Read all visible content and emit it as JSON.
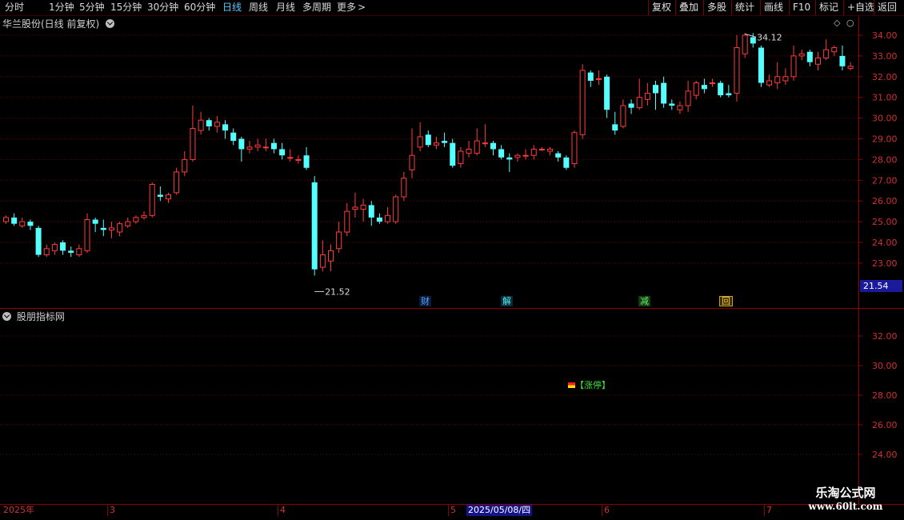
{
  "toolbar": {
    "periods": [
      "分时",
      "1分钟",
      "5分钟",
      "15分钟",
      "30分钟",
      "60分钟",
      "日线",
      "周线",
      "月线",
      "多周期",
      "更多"
    ],
    "active_period": "日线",
    "right_buttons": [
      "复权",
      "叠加",
      "多股",
      "统计",
      "画线",
      "F10",
      "标记",
      "+自选",
      "返回"
    ]
  },
  "main_pane": {
    "title": "华兰股份(日线 前复权)",
    "y_ticks": [
      "34.00",
      "33.00",
      "32.00",
      "31.00",
      "30.00",
      "29.00",
      "28.00",
      "27.00",
      "26.00",
      "25.00",
      "24.00",
      "23.00"
    ],
    "high_label": "34.12",
    "low_label": "21.52",
    "current_price": "21.54",
    "markers": [
      "财",
      "解",
      "减",
      "回"
    ]
  },
  "sub_pane": {
    "title": "股朋指标网",
    "y_ticks": [
      "32.00",
      "30.00",
      "28.00",
      "26.00",
      "24.00"
    ],
    "signal_label": "【涨停】"
  },
  "date_axis": {
    "labels": [
      "2025年",
      "3",
      "4",
      "5",
      "6",
      "7"
    ],
    "cursor_date": "2025/05/08/四"
  },
  "watermark": {
    "line1": "乐淘公式网",
    "line2": "www.60lt.com"
  },
  "colors": {
    "up": "#ff3c3c",
    "down": "#54ffff",
    "grid": "#7a0000",
    "accent": "#5cc8ff"
  },
  "chart_data": {
    "type": "candlestick",
    "ylim": [
      21.0,
      34.5
    ],
    "high": 34.12,
    "low": 21.52,
    "candles": [
      [
        25.0,
        25.2,
        24.9,
        25.3
      ],
      [
        25.2,
        24.9,
        24.8,
        25.4
      ],
      [
        24.8,
        25.0,
        24.7,
        25.2
      ],
      [
        25.0,
        24.8,
        24.6,
        25.1
      ],
      [
        24.7,
        23.4,
        23.3,
        24.8
      ],
      [
        23.4,
        23.7,
        23.3,
        23.9
      ],
      [
        23.6,
        23.9,
        23.4,
        24.0
      ],
      [
        24.0,
        23.6,
        23.4,
        24.1
      ],
      [
        23.6,
        23.5,
        23.3,
        23.8
      ],
      [
        23.4,
        23.7,
        23.3,
        23.9
      ],
      [
        23.6,
        25.1,
        23.5,
        25.4
      ],
      [
        25.1,
        24.9,
        24.5,
        25.2
      ],
      [
        24.7,
        24.6,
        24.3,
        25.1
      ],
      [
        24.6,
        24.7,
        24.2,
        25.0
      ],
      [
        24.5,
        24.9,
        24.3,
        25.0
      ],
      [
        24.8,
        25.0,
        24.7,
        25.2
      ],
      [
        25.0,
        25.2,
        24.9,
        25.3
      ],
      [
        25.2,
        25.3,
        25.1,
        25.5
      ],
      [
        25.3,
        26.8,
        25.2,
        26.9
      ],
      [
        26.3,
        26.2,
        26.0,
        26.7
      ],
      [
        26.1,
        26.3,
        25.9,
        26.4
      ],
      [
        26.4,
        27.4,
        26.3,
        27.6
      ],
      [
        27.4,
        28.0,
        27.2,
        28.4
      ],
      [
        28.0,
        29.5,
        27.9,
        30.6
      ],
      [
        29.4,
        29.9,
        29.2,
        30.3
      ],
      [
        29.9,
        29.6,
        29.4,
        30.0
      ],
      [
        29.6,
        29.8,
        29.3,
        30.1
      ],
      [
        29.7,
        29.4,
        29.0,
        29.9
      ],
      [
        29.3,
        28.9,
        28.7,
        29.5
      ],
      [
        29.0,
        28.5,
        27.9,
        29.1
      ],
      [
        28.5,
        28.6,
        28.3,
        28.9
      ],
      [
        28.6,
        28.7,
        28.4,
        29.0
      ],
      [
        28.6,
        28.6,
        28.4,
        29.0
      ],
      [
        28.8,
        28.5,
        28.3,
        29.0
      ],
      [
        28.5,
        28.2,
        28.0,
        28.8
      ],
      [
        28.1,
        28.1,
        27.9,
        28.5
      ],
      [
        28.0,
        28.0,
        27.8,
        28.2
      ],
      [
        28.2,
        27.6,
        27.5,
        28.6
      ],
      [
        26.9,
        22.7,
        22.4,
        27.2
      ],
      [
        22.8,
        23.4,
        22.6,
        24.1
      ],
      [
        23.1,
        23.6,
        22.6,
        23.9
      ],
      [
        23.7,
        24.5,
        23.5,
        25.0
      ],
      [
        24.5,
        25.5,
        24.3,
        25.9
      ],
      [
        25.6,
        25.7,
        25.2,
        26.4
      ],
      [
        25.6,
        25.8,
        25.0,
        26.1
      ],
      [
        25.8,
        25.2,
        24.8,
        26.0
      ],
      [
        25.2,
        25.0,
        24.9,
        25.4
      ],
      [
        25.0,
        25.3,
        24.9,
        25.7
      ],
      [
        25.0,
        26.2,
        24.9,
        26.3
      ],
      [
        26.2,
        27.1,
        26.0,
        27.4
      ],
      [
        27.5,
        28.2,
        27.1,
        29.5
      ],
      [
        28.6,
        29.1,
        28.4,
        29.8
      ],
      [
        29.2,
        28.7,
        28.6,
        29.4
      ],
      [
        28.7,
        28.8,
        28.5,
        29.1
      ],
      [
        28.9,
        28.8,
        28.6,
        29.3
      ],
      [
        28.8,
        27.7,
        27.6,
        29.0
      ],
      [
        27.8,
        28.4,
        27.6,
        28.6
      ],
      [
        28.3,
        28.5,
        28.1,
        28.9
      ],
      [
        28.3,
        28.9,
        28.2,
        29.5
      ],
      [
        28.8,
        28.8,
        28.6,
        29.7
      ],
      [
        28.8,
        28.5,
        28.2,
        28.9
      ],
      [
        28.5,
        28.1,
        28.0,
        28.7
      ],
      [
        28.1,
        28.0,
        27.4,
        28.3
      ],
      [
        28.1,
        28.2,
        27.9,
        28.3
      ],
      [
        28.2,
        28.2,
        28.0,
        28.5
      ],
      [
        28.2,
        28.5,
        28.0,
        28.7
      ],
      [
        28.5,
        28.5,
        28.4,
        28.6
      ],
      [
        28.4,
        28.5,
        28.2,
        28.6
      ],
      [
        28.3,
        28.1,
        27.9,
        28.4
      ],
      [
        28.1,
        27.6,
        27.5,
        28.2
      ],
      [
        27.8,
        29.3,
        27.6,
        29.4
      ],
      [
        29.2,
        32.3,
        29.0,
        32.6
      ],
      [
        32.2,
        31.8,
        31.5,
        32.3
      ],
      [
        31.9,
        31.9,
        31.6,
        32.3
      ],
      [
        32.0,
        30.4,
        30.0,
        32.1
      ],
      [
        29.7,
        29.4,
        29.2,
        30.3
      ],
      [
        29.6,
        30.6,
        29.5,
        30.9
      ],
      [
        30.7,
        30.5,
        30.2,
        30.9
      ],
      [
        30.5,
        31.0,
        30.4,
        31.9
      ],
      [
        30.9,
        31.2,
        30.6,
        31.7
      ],
      [
        31.6,
        31.2,
        30.4,
        31.8
      ],
      [
        31.7,
        30.7,
        30.5,
        32.0
      ],
      [
        30.7,
        30.6,
        30.4,
        30.9
      ],
      [
        30.4,
        30.6,
        30.2,
        30.8
      ],
      [
        30.6,
        31.3,
        30.3,
        31.8
      ],
      [
        31.1,
        31.7,
        30.9,
        31.8
      ],
      [
        31.6,
        31.4,
        31.2,
        31.9
      ],
      [
        31.7,
        31.7,
        31.5,
        31.9
      ],
      [
        31.7,
        31.1,
        31.0,
        31.8
      ],
      [
        31.2,
        31.1,
        31.0,
        31.6
      ],
      [
        31.2,
        33.4,
        30.8,
        34.0
      ],
      [
        33.1,
        34.0,
        32.9,
        34.1
      ],
      [
        33.9,
        33.6,
        33.4,
        34.1
      ],
      [
        33.4,
        31.7,
        31.5,
        33.5
      ],
      [
        31.6,
        31.8,
        31.5,
        32.1
      ],
      [
        31.7,
        32.0,
        31.4,
        32.7
      ],
      [
        31.8,
        32.0,
        31.6,
        32.4
      ],
      [
        32.0,
        33.0,
        31.8,
        33.5
      ],
      [
        33.0,
        33.1,
        32.8,
        33.3
      ],
      [
        33.2,
        32.7,
        32.5,
        33.3
      ],
      [
        32.6,
        32.9,
        32.3,
        33.2
      ],
      [
        32.9,
        33.3,
        32.8,
        33.8
      ],
      [
        33.2,
        33.4,
        33.0,
        33.5
      ],
      [
        33.0,
        32.5,
        32.3,
        33.5
      ],
      [
        32.4,
        32.5,
        32.3,
        32.7
      ]
    ]
  }
}
